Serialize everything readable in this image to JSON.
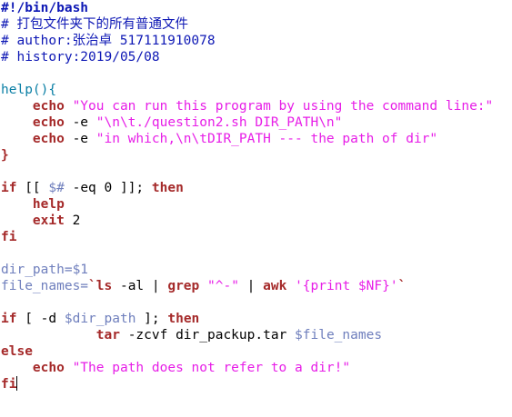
{
  "colors": {
    "comment": "#0e18b5",
    "keyword": "#a52a2a",
    "string": "#e71ee7",
    "variable": "#6f7fbd",
    "function": "#0a7fa5",
    "text": "#000000",
    "cursor": "#000000"
  },
  "lines": [
    [
      {
        "t": "#!/bin/bash",
        "c": "comment",
        "b": true
      }
    ],
    [
      {
        "t": "# 打包文件夹下的所有普通文件",
        "c": "comment"
      }
    ],
    [
      {
        "t": "# author:张治卓 517111910078",
        "c": "comment"
      }
    ],
    [
      {
        "t": "# history:2019/05/08",
        "c": "comment"
      }
    ],
    [],
    [
      {
        "t": "help(){",
        "c": "function"
      }
    ],
    [
      {
        "t": "    ",
        "c": "text"
      },
      {
        "t": "echo",
        "c": "keyword",
        "b": true
      },
      {
        "t": " ",
        "c": "text"
      },
      {
        "t": "\"You can run this program by using the command line:\"",
        "c": "string"
      }
    ],
    [
      {
        "t": "    ",
        "c": "text"
      },
      {
        "t": "echo",
        "c": "keyword",
        "b": true
      },
      {
        "t": " -e ",
        "c": "text"
      },
      {
        "t": "\"\\n\\t./question2.sh DIR_PATH\\n\"",
        "c": "string"
      }
    ],
    [
      {
        "t": "    ",
        "c": "text"
      },
      {
        "t": "echo",
        "c": "keyword",
        "b": true
      },
      {
        "t": " -e ",
        "c": "text"
      },
      {
        "t": "\"in which,\\n\\tDIR_PATH --- the path of dir\"",
        "c": "string"
      }
    ],
    [
      {
        "t": "}",
        "c": "keyword",
        "b": true
      }
    ],
    [],
    [
      {
        "t": "if",
        "c": "keyword",
        "b": true
      },
      {
        "t": " [[ ",
        "c": "text"
      },
      {
        "t": "$#",
        "c": "variable"
      },
      {
        "t": " -eq 0 ]]; ",
        "c": "text"
      },
      {
        "t": "then",
        "c": "keyword",
        "b": true
      }
    ],
    [
      {
        "t": "    ",
        "c": "text"
      },
      {
        "t": "help",
        "c": "keyword",
        "b": true
      }
    ],
    [
      {
        "t": "    ",
        "c": "text"
      },
      {
        "t": "exit",
        "c": "keyword",
        "b": true
      },
      {
        "t": " 2",
        "c": "text"
      }
    ],
    [
      {
        "t": "fi",
        "c": "keyword",
        "b": true
      }
    ],
    [],
    [
      {
        "t": "dir_path=$1",
        "c": "variable"
      }
    ],
    [
      {
        "t": "file_names=",
        "c": "variable"
      },
      {
        "t": "`",
        "c": "keyword",
        "b": true
      },
      {
        "t": "ls",
        "c": "keyword",
        "b": true
      },
      {
        "t": " -al | ",
        "c": "text"
      },
      {
        "t": "grep",
        "c": "keyword",
        "b": true
      },
      {
        "t": " ",
        "c": "text"
      },
      {
        "t": "\"^-\"",
        "c": "string"
      },
      {
        "t": " | ",
        "c": "text"
      },
      {
        "t": "awk",
        "c": "keyword",
        "b": true
      },
      {
        "t": " ",
        "c": "text"
      },
      {
        "t": "'{print $NF}'",
        "c": "string"
      },
      {
        "t": "`",
        "c": "keyword",
        "b": true
      }
    ],
    [],
    [
      {
        "t": "if",
        "c": "keyword",
        "b": true
      },
      {
        "t": " [ -d ",
        "c": "text"
      },
      {
        "t": "$dir_path",
        "c": "variable"
      },
      {
        "t": " ]; ",
        "c": "text"
      },
      {
        "t": "then",
        "c": "keyword",
        "b": true
      }
    ],
    [
      {
        "t": "            ",
        "c": "text"
      },
      {
        "t": "tar",
        "c": "keyword",
        "b": true
      },
      {
        "t": " -zcvf dir_packup.tar ",
        "c": "text"
      },
      {
        "t": "$file_names",
        "c": "variable"
      }
    ],
    [
      {
        "t": "else",
        "c": "keyword",
        "b": true
      }
    ],
    [
      {
        "t": "    ",
        "c": "text"
      },
      {
        "t": "echo",
        "c": "keyword",
        "b": true
      },
      {
        "t": " ",
        "c": "text"
      },
      {
        "t": "\"The path does not refer to a dir!\"",
        "c": "string"
      }
    ],
    [
      {
        "t": "fi",
        "c": "keyword",
        "b": true,
        "cursor": true
      }
    ]
  ]
}
